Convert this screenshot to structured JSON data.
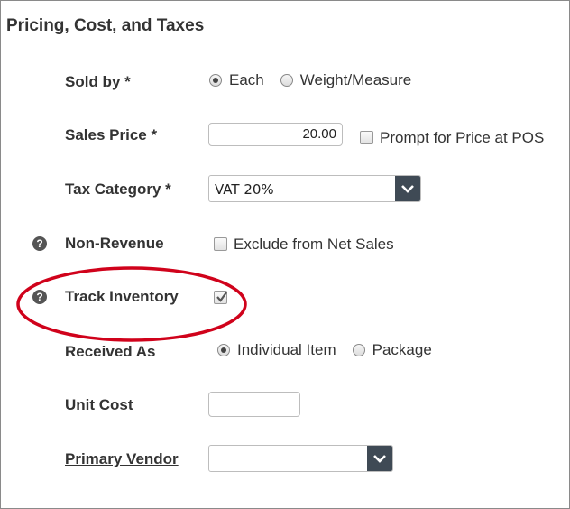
{
  "section": {
    "title": "Pricing, Cost, and Taxes"
  },
  "sold_by": {
    "label": "Sold by *",
    "options": [
      {
        "label": "Each",
        "selected": true
      },
      {
        "label": "Weight/Measure",
        "selected": false
      }
    ]
  },
  "sales_price": {
    "label": "Sales Price *",
    "value": "20.00",
    "prompt_label": "Prompt for Price at POS",
    "prompt_checked": false
  },
  "tax_category": {
    "label": "Tax Category *",
    "value": "VAT 20%"
  },
  "non_revenue": {
    "label": "Non-Revenue",
    "help_glyph": "?",
    "checkbox_label": "Exclude from Net Sales",
    "checked": false
  },
  "track_inventory": {
    "label": "Track Inventory",
    "help_glyph": "?",
    "checked": true
  },
  "received_as": {
    "label": "Received As",
    "options": [
      {
        "label": "Individual Item",
        "selected": true
      },
      {
        "label": "Package",
        "selected": false
      }
    ]
  },
  "unit_cost": {
    "label": "Unit Cost",
    "value": ""
  },
  "primary_vendor": {
    "label": "Primary Vendor",
    "value": ""
  },
  "icons": {
    "help": "question-circle-icon",
    "dropdown": "chevron-down-icon",
    "check": "checkmark-icon"
  },
  "colors": {
    "annotation": "#d0021b",
    "dropdown_button": "#3f4a55",
    "help_icon": "#555555"
  }
}
